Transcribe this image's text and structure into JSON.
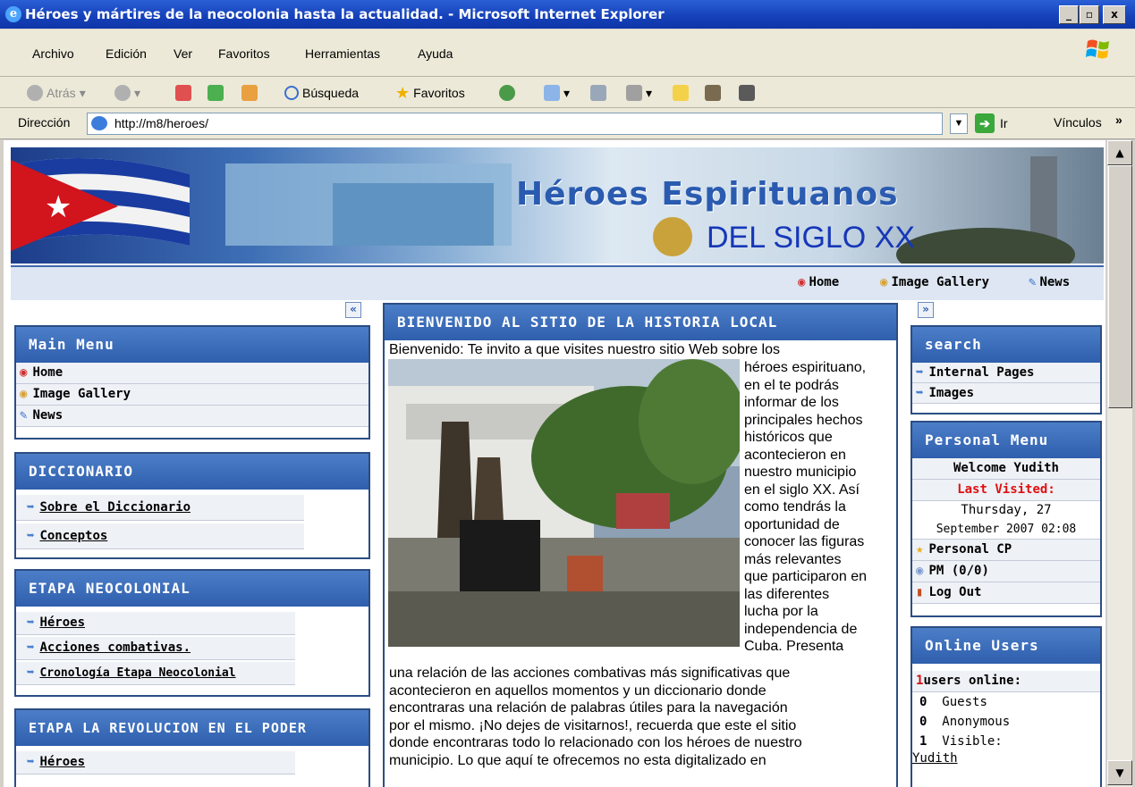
{
  "window": {
    "title": "Héroes y mártires de la neocolonia hasta la actualidad. - Microsoft Internet Explorer",
    "min": "_",
    "max": "▫",
    "close": "x"
  },
  "menu": [
    "Archivo",
    "Edición",
    "Ver",
    "Favoritos",
    "Herramientas",
    "Ayuda"
  ],
  "toolbar": {
    "back": "Atrás",
    "search": "Búsqueda",
    "favorites": "Favoritos"
  },
  "address": {
    "label": "Dirección",
    "url": "http://m8/heroes/",
    "go": "Ir",
    "links": "Vínculos"
  },
  "banner": {
    "title": "Héroes Espirituanos",
    "subtitle": "DEL SIGLO XX"
  },
  "topnav": [
    "Home",
    "Image Gallery",
    "News"
  ],
  "main_menu": {
    "title": "Main Menu",
    "items": [
      "Home",
      "Image Gallery",
      "News"
    ]
  },
  "diccionario": {
    "title": "DICCIONARIO",
    "items": [
      "Sobre el Diccionario",
      "Conceptos"
    ]
  },
  "neocolonial": {
    "title": "ETAPA NEOCOLONIAL",
    "items": [
      "Héroes",
      "Acciones combativas.",
      "Cronología Etapa Neocolonial"
    ]
  },
  "revolucion": {
    "title": "ETAPA LA REVOLUCION EN EL PODER",
    "items": [
      "Héroes"
    ]
  },
  "main": {
    "title": "BIENVENIDO AL SITIO DE LA HISTORIA LOCAL",
    "intro": "Bienvenido: Te invito a que visites nuestro sitio  Web sobre los",
    "side_lines": [
      "héroes espirituano,",
      "en el te podrás",
      "informar de los",
      "principales hechos",
      "históricos que",
      "acontecieron en",
      "nuestro municipio",
      "en el siglo XX. Así",
      "como tendrás la",
      "oportunidad de",
      "conocer las figuras",
      "más relevantes",
      "que participaron en",
      "las diferentes",
      "lucha por la",
      "independencia de",
      "Cuba. Presenta"
    ],
    "full_lines": [
      "una relación de las acciones combativas más significativas que",
      "acontecieron en aquellos momentos y un diccionario donde",
      "encontraras una relación de palabras útiles para la navegación",
      "por el mismo. ¡No dejes de visitarnos!, recuerda que este el sitio",
      "donde encontraras todo lo relacionado con los héroes de nuestro",
      "municipio. Lo que aquí te ofrecemos no esta digitalizado en"
    ]
  },
  "search": {
    "title": "search",
    "items": [
      "Internal Pages",
      "Images"
    ]
  },
  "personal": {
    "title": "Personal Menu",
    "welcome": "Welcome Yudith",
    "last_visited_label": "Last Visited:",
    "date1": "Thursday, 27",
    "date2": "September 2007 02:08",
    "items": [
      "Personal CP",
      "PM (0/0)",
      "Log Out"
    ]
  },
  "online": {
    "title": "Online Users",
    "count": "1",
    "count_label": " users online:",
    "rows": [
      {
        "n": "0",
        "label": "Guests"
      },
      {
        "n": "0",
        "label": "Anonymous"
      },
      {
        "n": "1",
        "label": "Visible:"
      }
    ],
    "user": "Yudith"
  },
  "colors": {
    "header_blue": "#2f5fad",
    "border_blue": "#2c4d84",
    "last_visited_red": "#e01010",
    "online_count_red": "#d01010"
  }
}
